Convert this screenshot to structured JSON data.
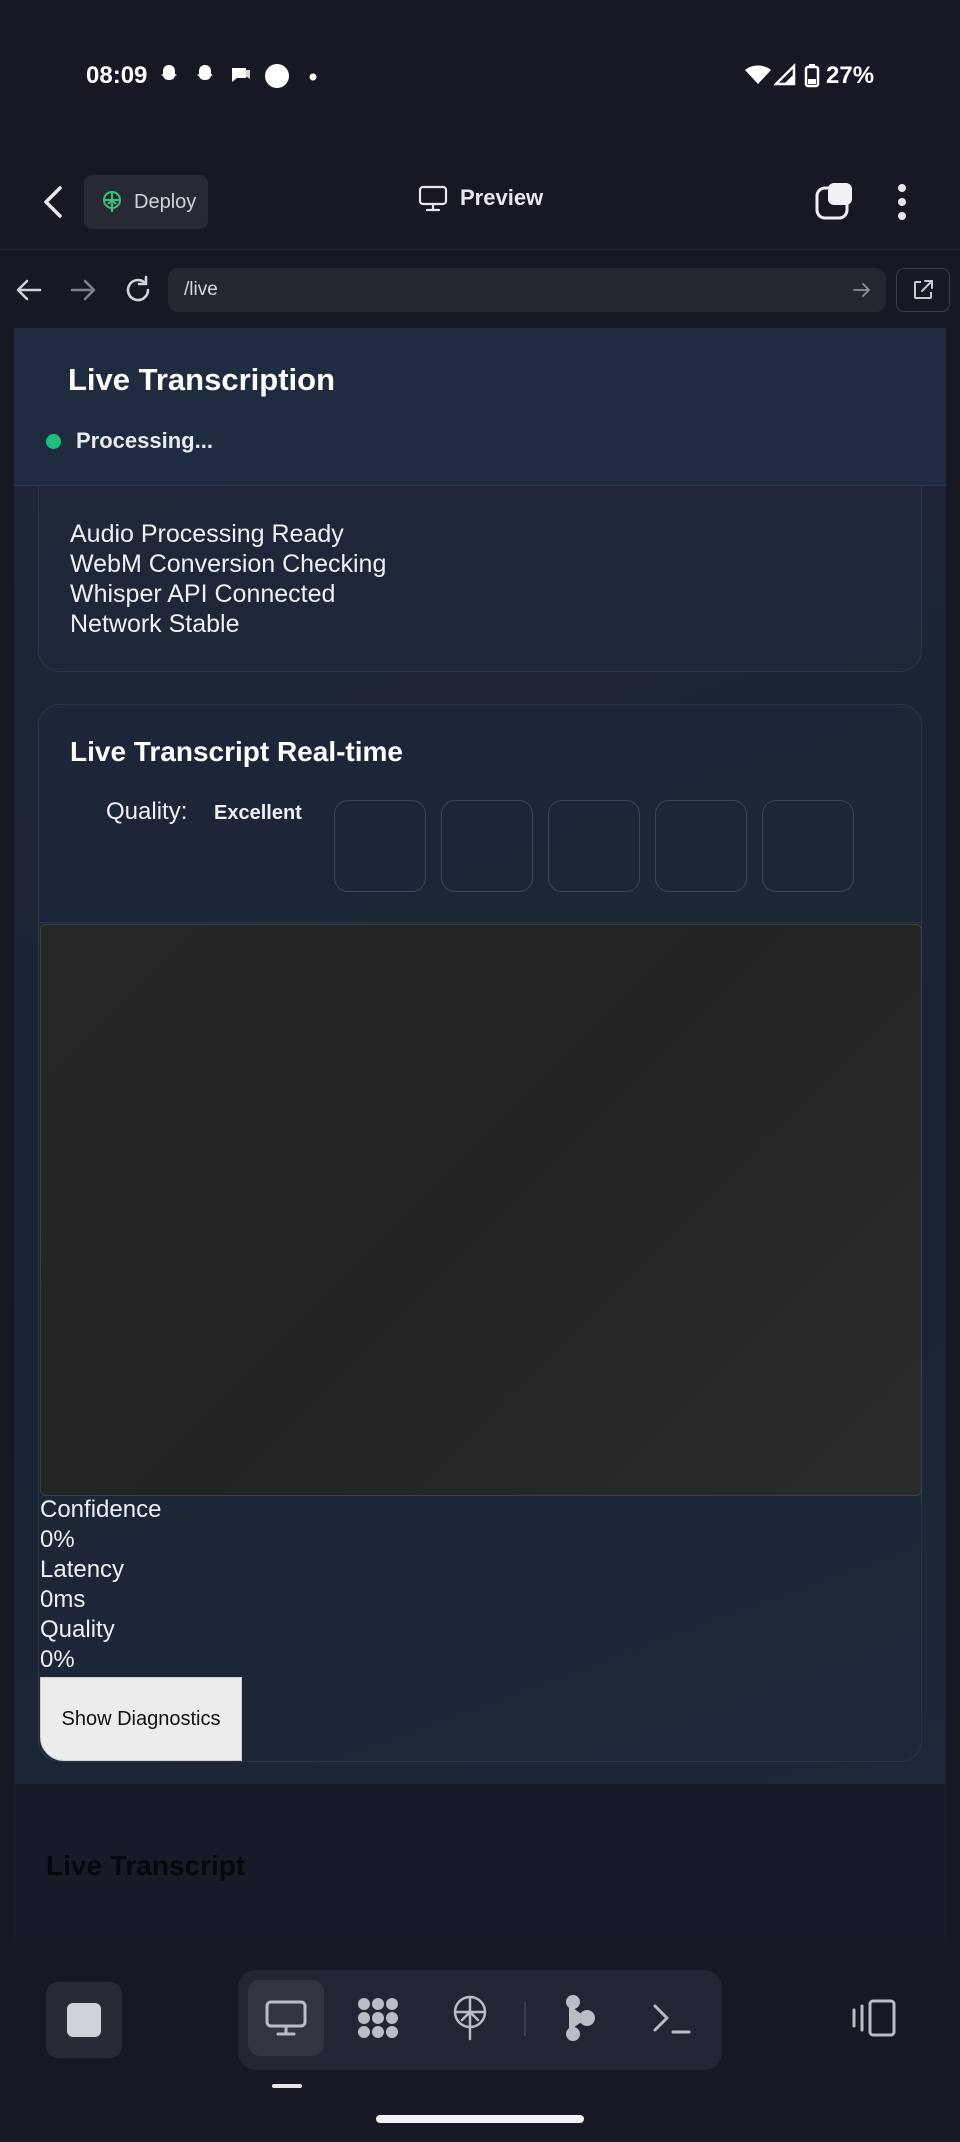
{
  "status_bar": {
    "time": "08:09",
    "battery": "27%",
    "notification_icons": [
      "snapchat-icon",
      "snapchat-icon",
      "chat-icon",
      "circle-icon",
      "dot-icon"
    ],
    "system_icons": [
      "wifi-icon",
      "signal-icon",
      "battery-icon"
    ]
  },
  "app_bar": {
    "deploy_label": "Deploy",
    "preview_label": "Preview"
  },
  "browser": {
    "url": "/live"
  },
  "page": {
    "title": "Live Transcription",
    "status": "Processing...",
    "status_color": "#1fbf7a",
    "checks": [
      "Audio Processing Ready",
      "WebM Conversion Checking",
      "Whisper API Connected",
      "Network Stable"
    ],
    "realtime": {
      "title": "Live Transcript Real-time",
      "quality_label": "Quality:",
      "quality_value": "Excellent",
      "quality_boxes": 5
    },
    "metrics": [
      {
        "label": "Confidence",
        "value": "0%"
      },
      {
        "label": "Latency",
        "value": "0ms"
      },
      {
        "label": "Quality",
        "value": "0%"
      }
    ],
    "diagnostics_button": "Show Diagnostics",
    "live_transcript_heading": "Live Transcript"
  },
  "bottom_bar": {
    "tools": [
      "monitor-icon",
      "apps-icon",
      "deploy-icon",
      "workflow-icon",
      "terminal-icon"
    ],
    "active_tool": "monitor-icon"
  }
}
